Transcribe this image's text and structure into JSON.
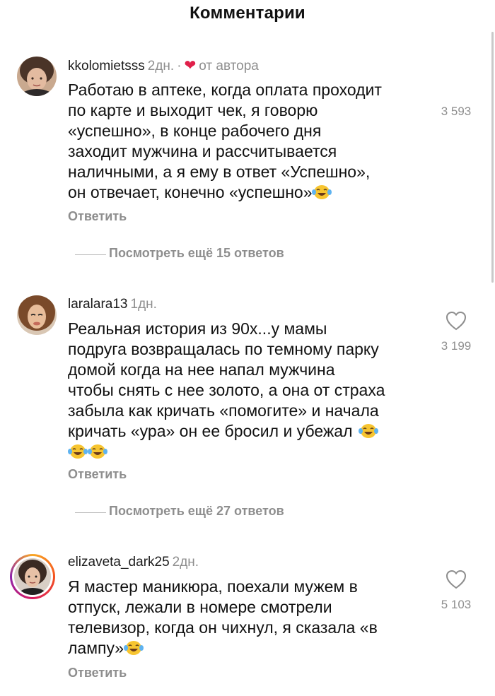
{
  "header": {
    "title": "Комментарии"
  },
  "comments": [
    {
      "username": "kkolomietsss",
      "time": "2дн.",
      "separator": "·",
      "author_badge": "от автора",
      "text": "Работаю в аптеке, когда оплата проходит\nпо карте и выходит чек, я говорю\n«успешно», в конце рабочего дня\nзаходит мужчина и рассчитывается\nналичными, а я ему в ответ «Успешно»,\nон отвечает, конечно «успешно»",
      "likes": "3 593",
      "reply_label": "Ответить",
      "more_replies": "Посмотреть ещё 15 ответов"
    },
    {
      "username": "laralara13",
      "time": "1дн.",
      "text": "Реальная история из 90х...у мамы\nподруга возвращалась по темному парку\nдомой когда на нее напал мужчина\nчтобы снять с нее золото, а она от страха\nзабыла как кричать «помогите» и начала\nкричать «ура» он ее бросил и убежал",
      "likes": "3 199",
      "reply_label": "Ответить",
      "more_replies": "Посмотреть ещё 27 ответов"
    },
    {
      "username": "elizaveta_dark25",
      "time": "2дн.",
      "text": "Я мастер маникюра, поехали мужем в\nотпуск, лежали в номере смотрели\nтелевизор, когда он чихнул, я сказала «в\nлампу»",
      "likes": "5 103",
      "reply_label": "Ответить"
    }
  ],
  "icons": {
    "like": "heart-outline-icon",
    "author_like": "heart-filled-icon",
    "emoji": "laughing-tears-emoji"
  },
  "colors": {
    "muted": "#8e8e8e",
    "author_heart": "#e0204a",
    "story_ring": [
      "#f9a825",
      "#f4511e",
      "#d81b60",
      "#8e24aa"
    ]
  }
}
